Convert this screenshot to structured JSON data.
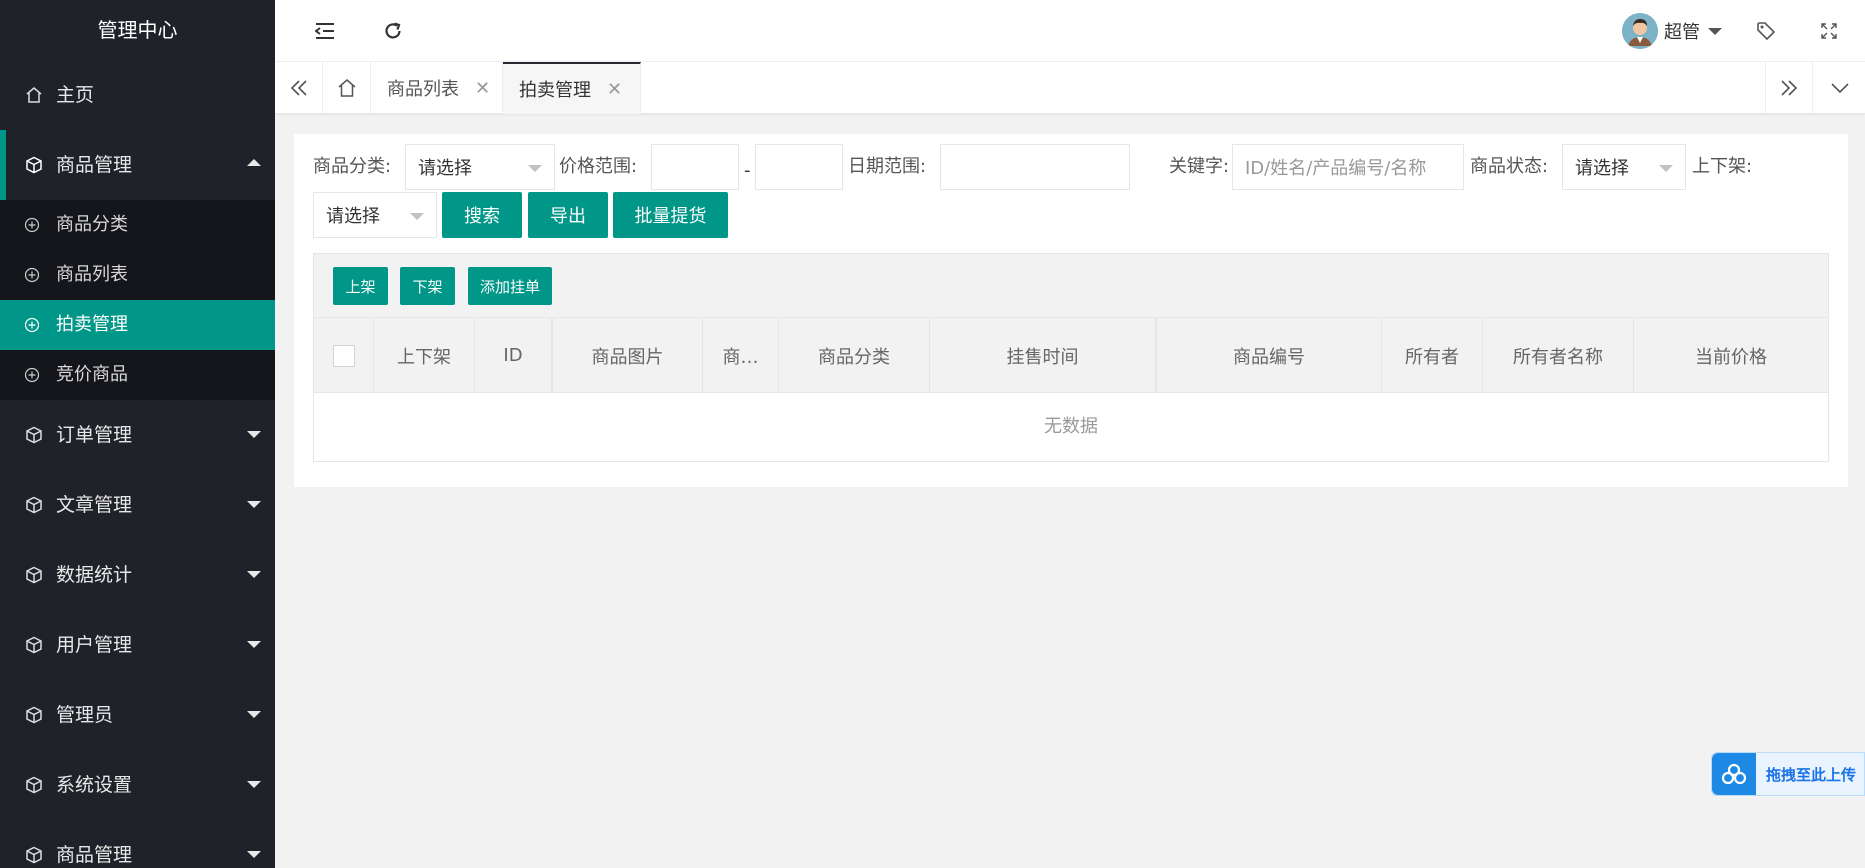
{
  "sidebar": {
    "logo": "管理中心",
    "home": "主页",
    "open_group": "商品管理",
    "sub_items": [
      "商品分类",
      "商品列表",
      "拍卖管理",
      "竞价商品"
    ],
    "groups": [
      "订单管理",
      "文章管理",
      "数据统计",
      "用户管理",
      "管理员",
      "系统设置",
      "商品管理"
    ]
  },
  "header": {
    "user_name": "超管"
  },
  "tabs": [
    {
      "label": "商品列表",
      "close": "✕"
    },
    {
      "label": "拍卖管理",
      "close": "✕"
    }
  ],
  "filters": {
    "category_label": "商品分类:",
    "category_value": "请选择",
    "price_label": "价格范围:",
    "price_sep": "-",
    "date_label": "日期范围:",
    "keyword_label": "关键字:",
    "keyword_placeholder": "ID/姓名/产品编号/名称",
    "status_label": "商品状态:",
    "status_value": "请选择",
    "shelf_label": "上下架:",
    "shelf_value": "请选择",
    "search_btn": "搜索",
    "export_btn": "导出",
    "batch_btn": "批量提货"
  },
  "table": {
    "toolbar": [
      "上架",
      "下架",
      "添加挂单"
    ],
    "columns": [
      "上下架",
      "ID",
      "商品图片",
      "商…",
      "商品分类",
      "挂售时间",
      "商品编号",
      "所有者",
      "所有者名称",
      "当前价格"
    ],
    "empty_text": "无数据"
  },
  "upload_widget": {
    "label": "拖拽至此上传"
  },
  "colors": {
    "primary": "#009688",
    "sidebar_bg": "#20222a",
    "sub_bg": "#15161b"
  }
}
